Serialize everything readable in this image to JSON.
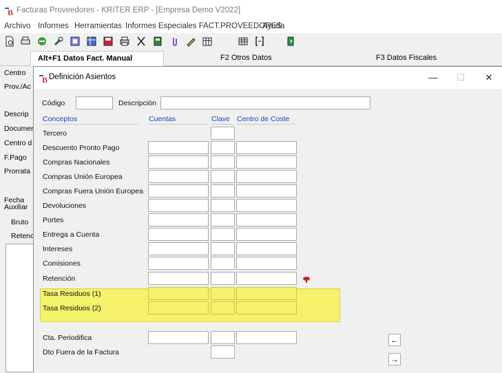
{
  "window": {
    "title": "Facturas Proveedores  - KRITER ERP - [Empresa Demo V2022]"
  },
  "menu": [
    "Archivo",
    "Informes",
    "Herramientas",
    "Informes Especiales FACT.PROVEEDORES",
    "Ayuda"
  ],
  "tabs": [
    {
      "label": "Alt+F1 Datos Fact. Manual",
      "active": true
    },
    {
      "label": "F2 Otros Datos",
      "active": false
    },
    {
      "label": "F3 Datos Fiscales",
      "active": false
    }
  ],
  "left_labels": [
    "Centro",
    "Prov./Ac",
    "Descrip",
    "Documen",
    "Centro d",
    "F.Pago",
    "Prorrata",
    "Fecha",
    "Auxiliar",
    "Bruto",
    "Retenc"
  ],
  "dialog": {
    "title": "Definición Asientos",
    "controls": {
      "minimize": "—",
      "maximize": "☐",
      "close": "✕"
    },
    "codigo_label": "Código",
    "descripcion_label": "Descripción",
    "codigo_value": "",
    "descripcion_value": "",
    "headers": {
      "conceptos": "Conceptos",
      "cuentas": "Cuentas",
      "clave": "Clave",
      "centro_coste": "Centro de Coste"
    },
    "rows": [
      {
        "concepto": "Tercero"
      },
      {
        "concepto": "Descuento Pronto Pago"
      },
      {
        "concepto": "Compras Nacionales"
      },
      {
        "concepto": "Compras Unión Europea"
      },
      {
        "concepto": "Compras Fuera Unión Europea"
      },
      {
        "concepto": "Devoluciones"
      },
      {
        "concepto": "Portes"
      },
      {
        "concepto": "Entrega a Cuenta"
      },
      {
        "concepto": "Intereses"
      },
      {
        "concepto": "Comisiones"
      },
      {
        "concepto": "Retención"
      },
      {
        "concepto": "Tasa Residuos (1)"
      },
      {
        "concepto": "Tasa Residuos (2)"
      }
    ],
    "extra_rows": [
      {
        "concepto": "Cta. Periodifica"
      },
      {
        "concepto": "Dto Fuera de la Factura"
      }
    ],
    "highlight_color": "#f4f26a",
    "arrows": {
      "left": "←",
      "right": "→"
    }
  }
}
